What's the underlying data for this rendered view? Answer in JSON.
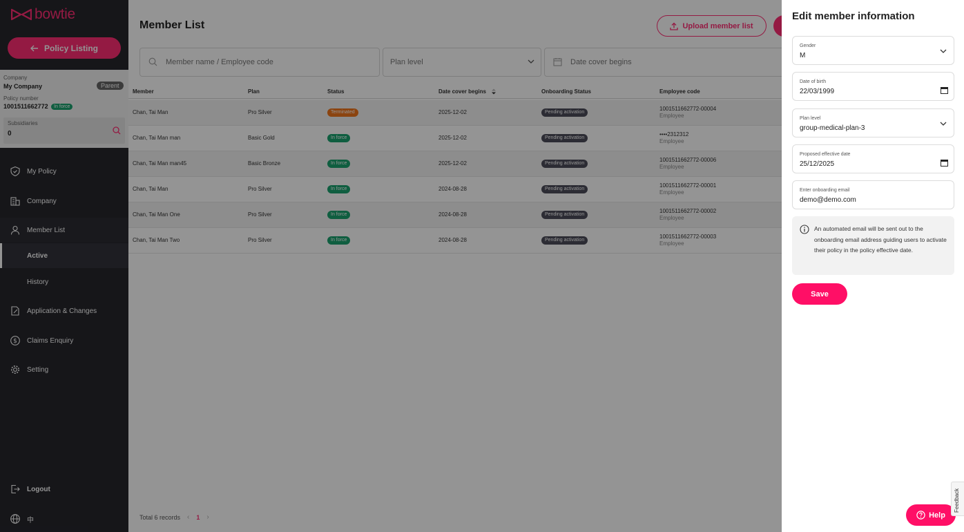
{
  "brand": {
    "name": "bowtie",
    "color": "#ff2e74"
  },
  "sidebar": {
    "policy_button": "Policy Listing",
    "company_label": "Company",
    "company_name": "My Company",
    "parent_badge": "Parent",
    "policy_number_label": "Policy number",
    "policy_number": "1001511662772",
    "policy_status": "In force",
    "subsidiaries_label": "Subsidiaries",
    "subsidiaries_count": "0",
    "nav": {
      "my_policy": "My Policy",
      "company": "Company",
      "member_list": "Member List",
      "active": "Active",
      "history": "History",
      "applications": "Application & Changes",
      "claims": "Claims Enquiry",
      "setting": "Setting",
      "logout": "Logout",
      "language": "中"
    }
  },
  "main": {
    "title": "Member List",
    "upload_button": "Upload member list",
    "filters": {
      "search_placeholder": "Member name / Employee code",
      "plan_placeholder": "Plan level",
      "date_placeholder": "Date cover begins"
    },
    "columns": {
      "member": "Member",
      "plan": "Plan",
      "status": "Status",
      "date_cover": "Date cover begins",
      "onboarding": "Onboarding Status",
      "employee_code": "Employee code"
    },
    "rows": [
      {
        "member": "Chan, Tai Man",
        "plan": "Pro Silver",
        "status": "Terminated",
        "date": "2025-12-02",
        "onboarding": "Pending activation",
        "code": "1001511662772-00004",
        "role": "Employee"
      },
      {
        "member": "Chan, Tai Man man",
        "plan": "Basic Gold",
        "status": "In force",
        "date": "2025-12-02",
        "onboarding": "Pending activation",
        "code": "••••2312312",
        "role": "Employee"
      },
      {
        "member": "Chan, Tai Man man45",
        "plan": "Basic Bronze",
        "status": "In force",
        "date": "2025-12-02",
        "onboarding": "Pending activation",
        "code": "1001511662772-00006",
        "role": "Employee"
      },
      {
        "member": "Chan, Tai Man",
        "plan": "Pro Silver",
        "status": "In force",
        "date": "2024-08-28",
        "onboarding": "Pending activation",
        "code": "1001511662772-00001",
        "role": "Employee"
      },
      {
        "member": "Chan, Tai Man One",
        "plan": "Pro Silver",
        "status": "In force",
        "date": "2024-08-28",
        "onboarding": "Pending activation",
        "code": "1001511662772-00002",
        "role": "Employee"
      },
      {
        "member": "Chan, Tai Man Two",
        "plan": "Pro Silver",
        "status": "In force",
        "date": "2024-08-28",
        "onboarding": "Pending activation",
        "code": "1001511662772-00003",
        "role": "Employee"
      }
    ],
    "pagination": {
      "total": "Total 6 records",
      "prev": "‹",
      "page": "1",
      "next": "›"
    }
  },
  "drawer": {
    "title": "Edit member information",
    "gender": {
      "label": "Gender",
      "value": "M"
    },
    "dob": {
      "label": "Date of birth",
      "value": "22/03/1999"
    },
    "plan_level": {
      "label": "Plan level",
      "value": "group-medical-plan-3"
    },
    "effective_date": {
      "label": "Proposed effective date",
      "value": "25/12/2025"
    },
    "email": {
      "label": "Enter onboarding email",
      "value": "demo@demo.com"
    },
    "info": "An automated email will be sent out to the onboarding email address guiding users to activate their policy in the policy effective date.",
    "save_button": "Save"
  },
  "help_button": "Help",
  "feedback_tab": "Feedback"
}
